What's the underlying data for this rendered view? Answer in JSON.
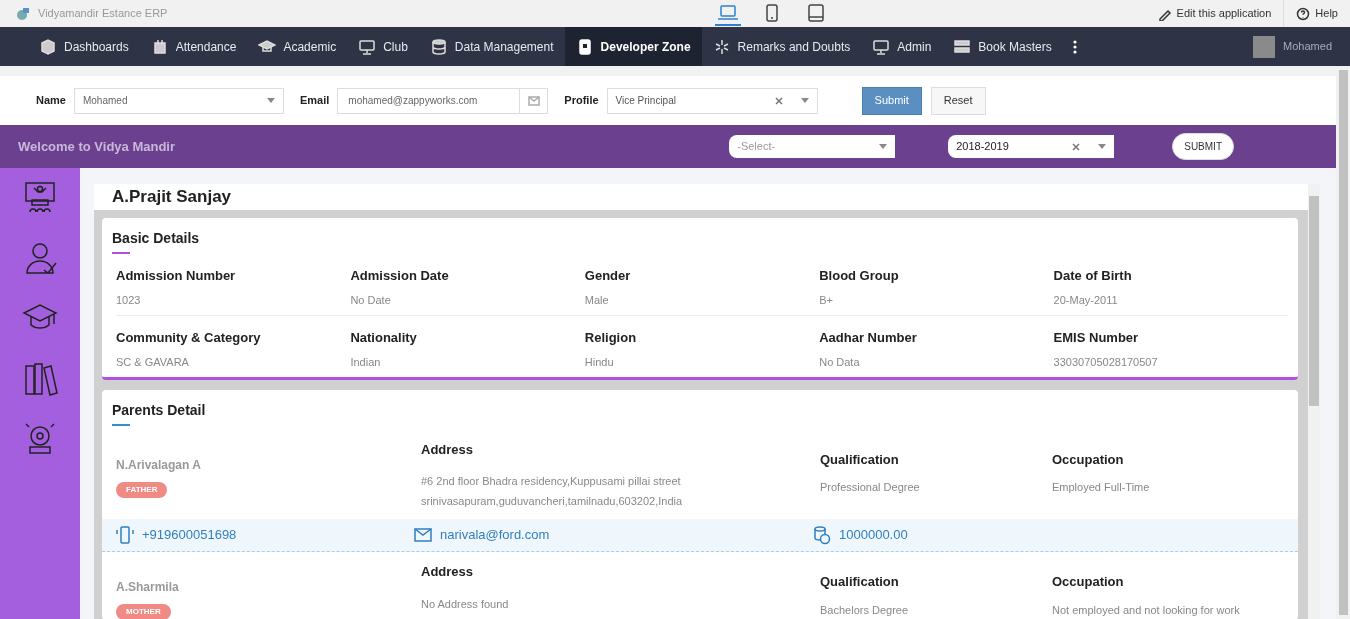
{
  "title_bar": {
    "app_title": "Vidyamandir Estance ERP",
    "devices": [
      {
        "kind": "laptop",
        "selected": true
      },
      {
        "kind": "phone",
        "selected": false
      },
      {
        "kind": "tablet",
        "selected": false
      }
    ],
    "links": [
      {
        "kind": "edit",
        "label": "Edit this application"
      },
      {
        "kind": "help",
        "label": "Help"
      }
    ]
  },
  "nav": {
    "items": [
      {
        "label": "Dashboards",
        "selected": false
      },
      {
        "label": "Attendance",
        "selected": false
      },
      {
        "label": "Academic",
        "selected": false
      },
      {
        "label": "Club",
        "selected": false
      },
      {
        "label": "Data Management",
        "selected": false
      },
      {
        "label": "Developer Zone",
        "selected": true
      },
      {
        "label": "Remarks and Doubts",
        "selected": false
      },
      {
        "label": "Admin",
        "selected": false
      },
      {
        "label": "Book Masters",
        "selected": false
      }
    ],
    "user": {
      "name": "Mohamed"
    }
  },
  "filter_form": {
    "name": {
      "label": "Name",
      "value": "Mohamed"
    },
    "email": {
      "label": "Email",
      "value": "mohamed@zappyworks.com"
    },
    "profile": {
      "label": "Profile",
      "value": "Vice Principal"
    },
    "buttons": [
      {
        "kind": "primary",
        "label": "Submit"
      },
      {
        "kind": "secondary",
        "label": "Reset"
      }
    ]
  },
  "banner": {
    "welcome": "Welcome to Vidya Mandir",
    "class_select": {
      "placeholder": "-Select-"
    },
    "year_select": {
      "value": "2018-2019"
    },
    "submit": "SUBMIT"
  },
  "student": {
    "name": "A.Prajit Sanjay"
  },
  "basic_details": {
    "title": "Basic Details",
    "fields": [
      {
        "label": "Admission Number",
        "value": "1023"
      },
      {
        "label": "Admission Date",
        "value": "No Date"
      },
      {
        "label": "Gender",
        "value": "Male"
      },
      {
        "label": "Blood Group",
        "value": "B+"
      },
      {
        "label": "Date of Birth",
        "value": "20-May-2011"
      },
      {
        "label": "Community & Category",
        "value": "SC & GAVARA"
      },
      {
        "label": "Nationality",
        "value": "Indian"
      },
      {
        "label": "Religion",
        "value": "Hindu"
      },
      {
        "label": "Aadhar Number",
        "value": "No Data"
      },
      {
        "label": "EMIS Number",
        "value": "33030705028170507"
      }
    ]
  },
  "parents_detail": {
    "title": "Parents Detail",
    "parents": [
      {
        "name": "N.Arivalagan A",
        "relation": "FATHER",
        "address_label": "Address",
        "address": "#6 2nd floor Bhadra residency,Kuppusami pillai street srinivasapuram,guduvancheri,tamilnadu,603202,India",
        "qualification_label": "Qualification",
        "qualification": "Professional Degree",
        "occupation_label": "Occupation",
        "occupation": "Employed Full-Time",
        "contact": {
          "phone": "+919600051698",
          "email": "narivala@ford.com",
          "income": "1000000.00"
        }
      },
      {
        "name": "A.Sharmila",
        "relation": "MOTHER",
        "address_label": "Address",
        "address": "No Address found",
        "qualification_label": "Qualification",
        "qualification": "Bachelors Degree",
        "occupation_label": "Occupation",
        "occupation": "Not employed and not looking for work"
      }
    ]
  }
}
